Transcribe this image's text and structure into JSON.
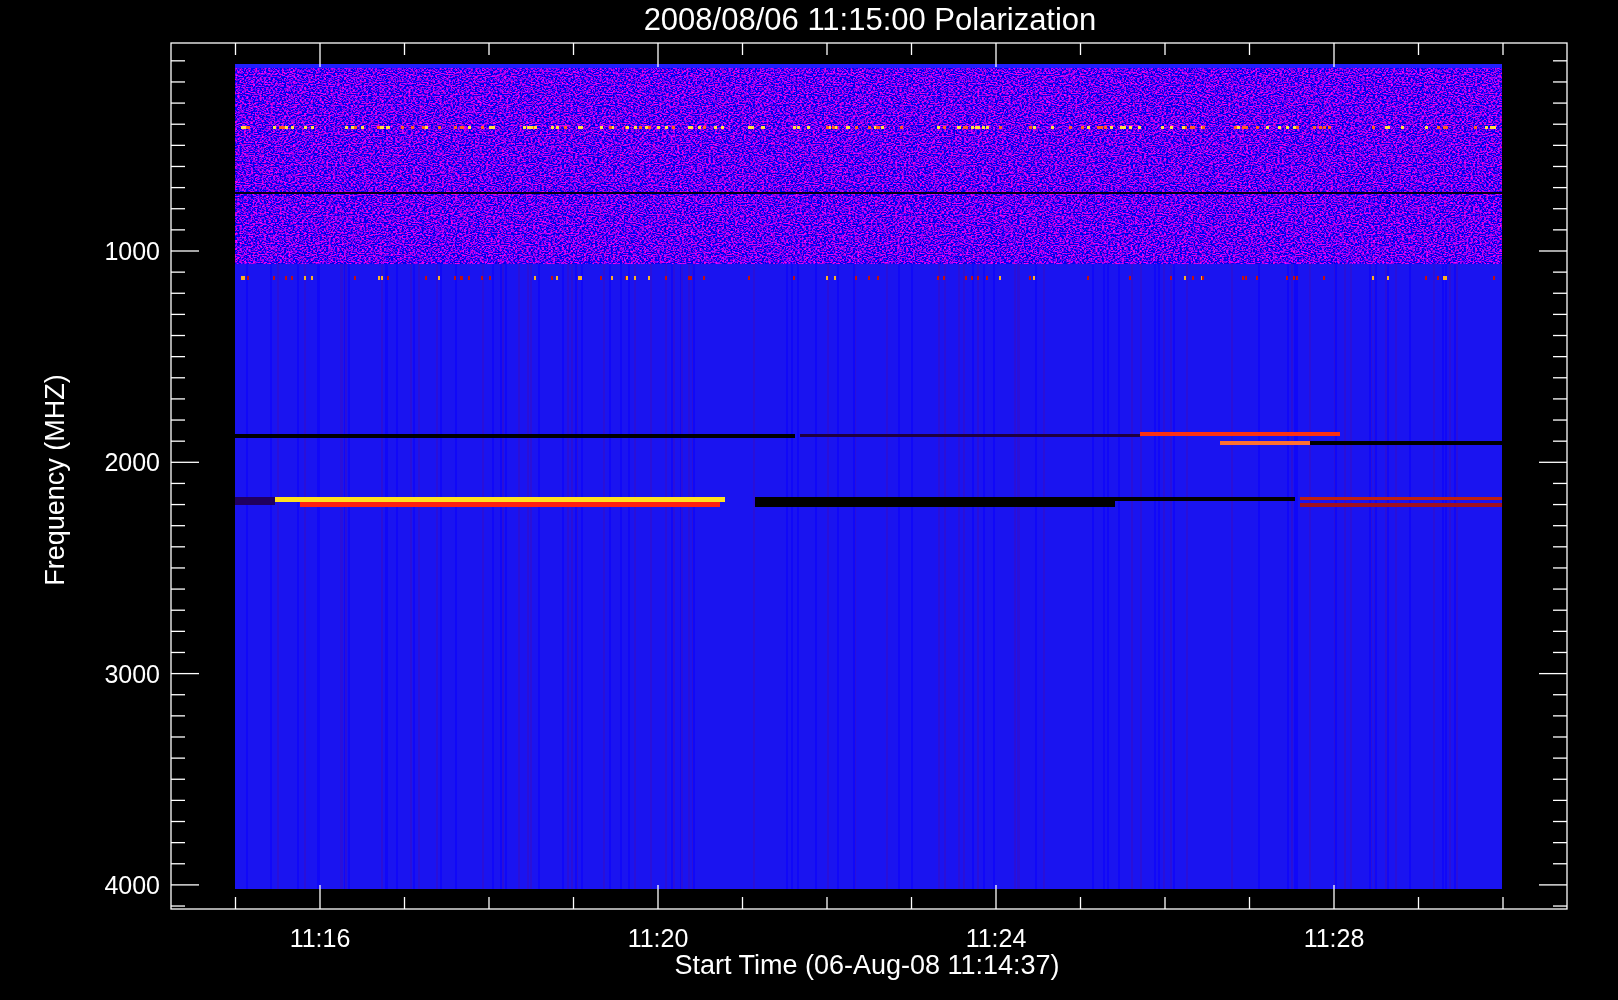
{
  "title": "2008/08/06 11:15:00 Polarization",
  "y_axis": {
    "label": "Frequency (MHZ)",
    "tick_labels": [
      "1000",
      "2000",
      "3000",
      "4000"
    ]
  },
  "x_axis": {
    "label": "Start Time (06-Aug-08 11:14:37)",
    "tick_labels": [
      "11:16",
      "11:20",
      "11:24",
      "11:28"
    ]
  }
}
